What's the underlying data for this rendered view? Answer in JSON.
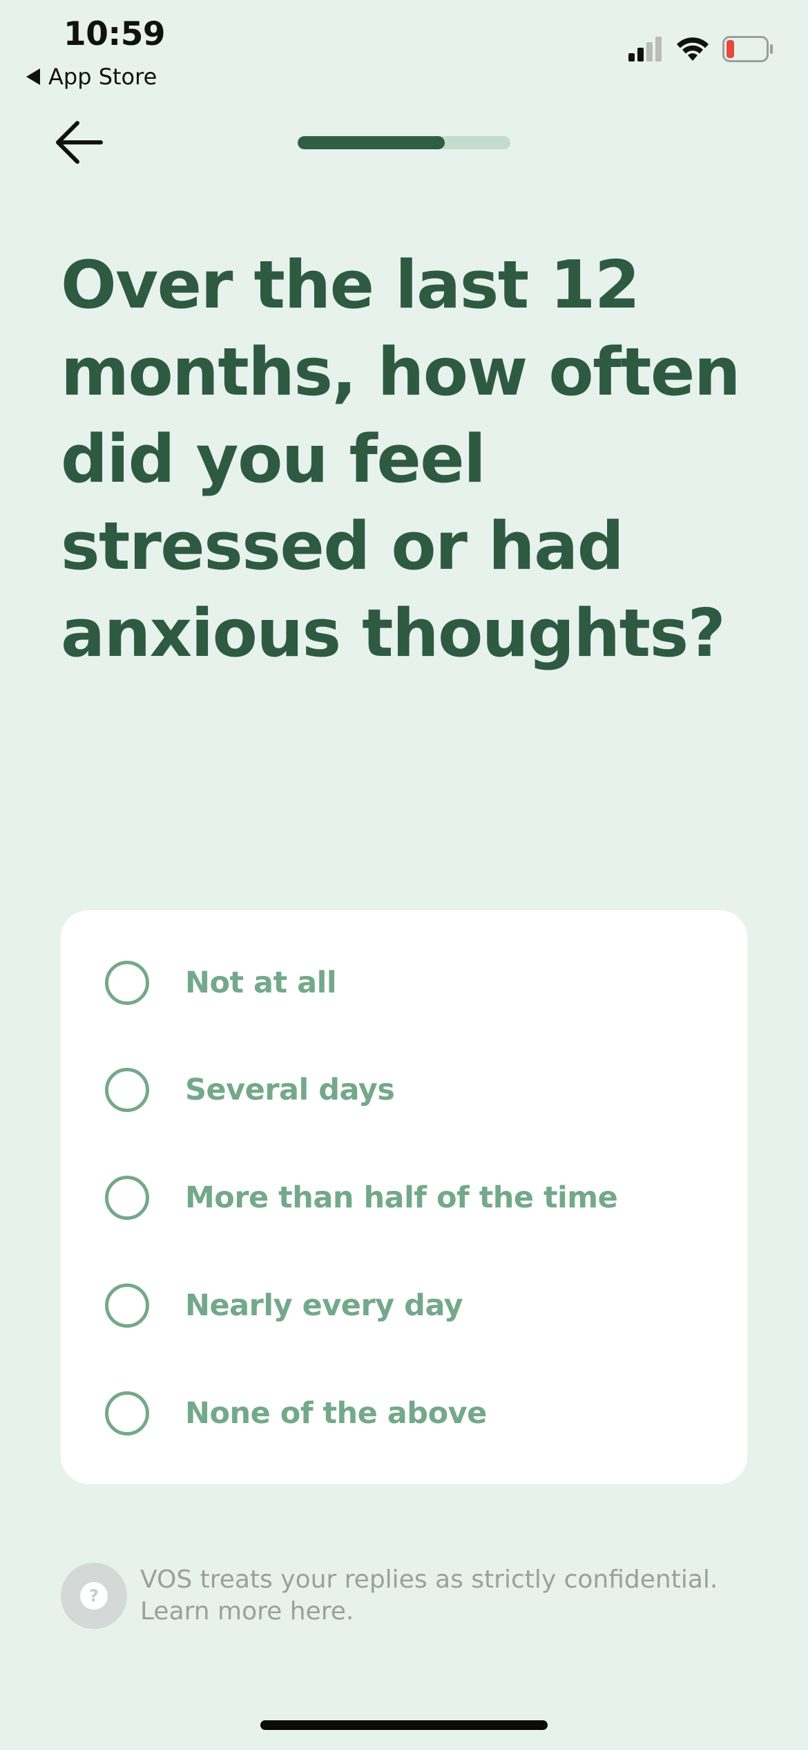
{
  "status_bar": {
    "time": "10:59",
    "back_app_label": "App Store",
    "signal_icon": "cellular-signal-icon",
    "wifi_icon": "wifi-icon",
    "battery_icon": "battery-low-icon",
    "battery_level_color": "#e5483d"
  },
  "navigation": {
    "back_icon": "arrow-left-icon",
    "progress": 0.69
  },
  "question": {
    "text": "Over the last 12 months, how often did you feel stressed or had anxious thoughts?"
  },
  "options": [
    {
      "label": "Not at all",
      "selected": false
    },
    {
      "label": "Several days",
      "selected": false
    },
    {
      "label": "More than half of the time",
      "selected": false
    },
    {
      "label": "Nearly every day",
      "selected": false
    },
    {
      "label": "None of the above",
      "selected": false
    }
  ],
  "footer": {
    "help_icon": "question-mark-icon",
    "help_glyph": "?",
    "disclaimer_text": "VOS treats your replies as strictly confidential.",
    "learn_more_text": "Learn more here."
  },
  "colors": {
    "background": "#e8f2ec",
    "heading": "#2e5a42",
    "accent": "#74a88a",
    "progress_fill": "#2e5e44",
    "progress_track": "#c4dcce"
  }
}
